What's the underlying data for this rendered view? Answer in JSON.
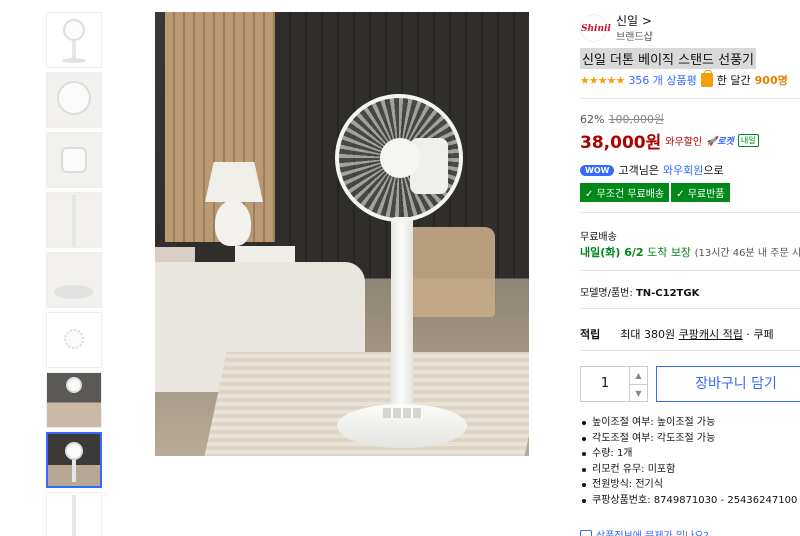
{
  "thumbnails": [
    {
      "label": "thumb-1"
    },
    {
      "label": "thumb-2"
    },
    {
      "label": "thumb-3"
    },
    {
      "label": "thumb-4"
    },
    {
      "label": "thumb-5"
    },
    {
      "label": "thumb-6"
    },
    {
      "label": "thumb-7"
    },
    {
      "label": "thumb-8",
      "selected": true
    },
    {
      "label": "thumb-9"
    }
  ],
  "brand": {
    "logo_text": "Shinil",
    "name": "신일 >",
    "sub": "브랜드샵"
  },
  "product": {
    "title": "신일 더톤 베이직 스탠드 선풍기",
    "stars": "★★★★★",
    "review_count": "356 개 상품평",
    "monthly_label": "한 달간",
    "monthly_value": "900명"
  },
  "price": {
    "discount": "62%",
    "original": "100,000원",
    "sale": "38,000원",
    "wow_label": "와우할인",
    "rocket_label": "🚀로켓",
    "tomorrow_badge": "내일"
  },
  "member": {
    "badge": "WOW",
    "text_before": "고객님은",
    "member_link": "와우회원",
    "text_after": "으로"
  },
  "chips": [
    "✓ 무조건 무료배송",
    "✓ 무료반품"
  ],
  "shipping": {
    "label": "무료배송",
    "date": "내일(화) 6/2",
    "guarantee": "도착 보장",
    "cutoff": "(13시간 46분 내 주문 시"
  },
  "model": {
    "label": "모델명/품번:",
    "value": "TN-C12TGK"
  },
  "reward": {
    "label": "적립",
    "amount": "최대 380원",
    "link": "쿠팡캐시 적립",
    "more": "· 쿠페"
  },
  "quantity": {
    "value": "1",
    "up": "▲",
    "down": "▼"
  },
  "cart_button": "장바구니 담기",
  "specs": [
    "높이조절 여부: 높이조절 가능",
    "각도조절 여부: 각도조절 가능",
    "수량: 1개",
    "리모컨 유무: 미포함",
    "전원방식: 전기식",
    "쿠팡상품번호: 8749871030 - 25436247100"
  ],
  "report_link": "상품정보에 문제가 있나요?"
}
